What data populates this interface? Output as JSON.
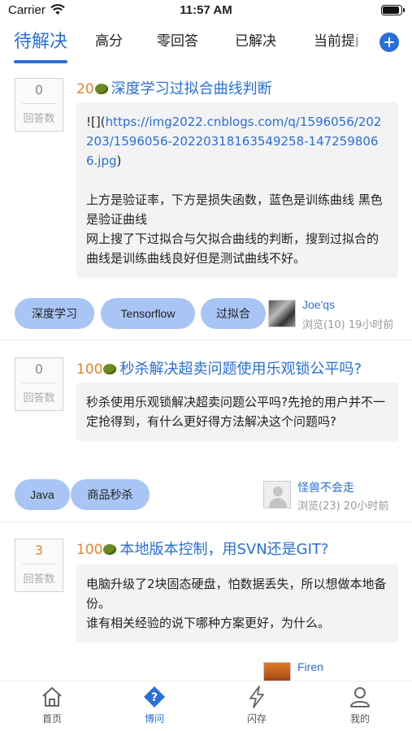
{
  "status_bar": {
    "carrier": "Carrier",
    "time": "11:57 AM"
  },
  "tabs": [
    {
      "label": "待解决",
      "active": true
    },
    {
      "label": "高分",
      "active": false
    },
    {
      "label": "零回答",
      "active": false
    },
    {
      "label": "已解决",
      "active": false
    },
    {
      "label": "当前提问",
      "active": false
    }
  ],
  "answer_label": "回答数",
  "questions": [
    {
      "answers": "0",
      "bounty": "20",
      "title": "深度学习过拟合曲线判断",
      "body_prefix": "![](",
      "body_link": "https://img2022.cnblogs.com/q/1596056/202203/1596056-20220318163549258-1472598066.jpg",
      "body_suffix": ")",
      "body_lines": [
        "上方是验证率，下方是损失函数，蓝色是训练曲线 黑色是验证曲线",
        "网上搜了下过拟合与欠拟合曲线的判断，搜到过拟合的曲线是训练曲线良好但是测试曲线不好。"
      ],
      "tags": [
        "深度学习",
        "Tensorflow",
        "过拟合"
      ],
      "user": "Joe'qs",
      "meta": "浏览(10) 19小时前"
    },
    {
      "answers": "0",
      "bounty": "100",
      "title": "秒杀解决超卖问题使用乐观锁公平吗?",
      "body_lines": [
        "秒杀使用乐观锁解决超卖问题公平吗?先抢的用户并不一定抢得到，有什么更好得方法解决这个问题吗?"
      ],
      "tags": [
        "Java",
        "商品秒杀"
      ],
      "user": "怪兽不会走",
      "meta": "浏览(23) 20小时前"
    },
    {
      "answers": "3",
      "bounty": "100",
      "title": "本地版本控制，用SVN还是GIT?",
      "body_lines": [
        "电脑升级了2块固态硬盘，怕数据丢失，所以想做本地备份。",
        "谁有相关经验的说下哪种方案更好，为什么。"
      ],
      "tags": [],
      "user": "Firen",
      "meta": ""
    }
  ],
  "tabbar": [
    {
      "label": "首页",
      "icon": "home-icon",
      "active": false
    },
    {
      "label": "博问",
      "icon": "question-icon",
      "active": true
    },
    {
      "label": "闪存",
      "icon": "flash-icon",
      "active": false
    },
    {
      "label": "我的",
      "icon": "profile-icon",
      "active": false
    }
  ],
  "colors": {
    "accent": "#2a6fd6",
    "bounty": "#e8842c",
    "tag_bg": "#a9c5f5"
  }
}
